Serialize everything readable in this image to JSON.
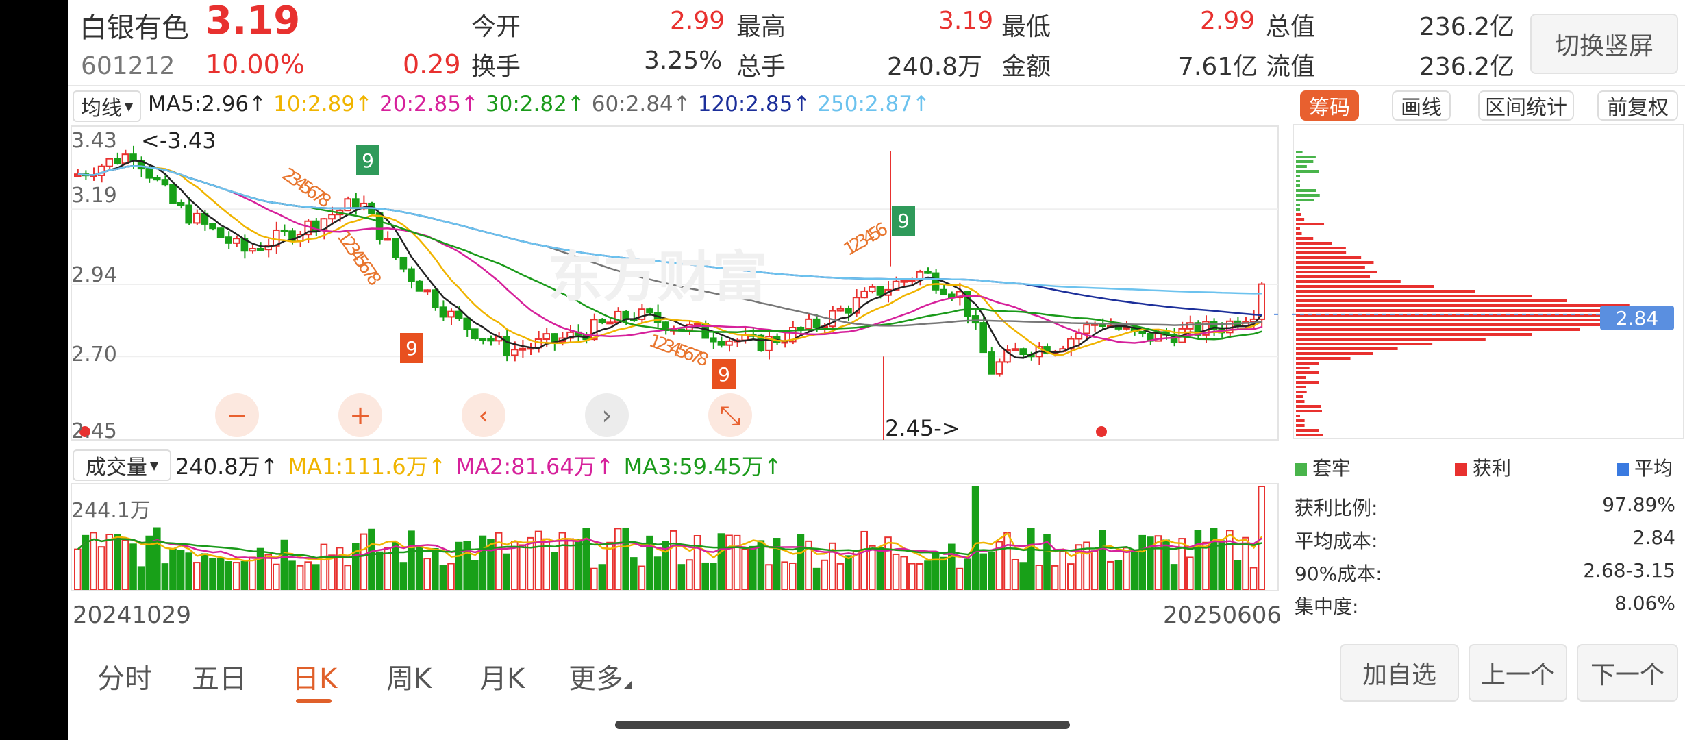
{
  "stock": {
    "name": "白银有色",
    "price": "3.19",
    "code": "601212",
    "change_pct": "10.00%",
    "change": "0.29"
  },
  "quote": [
    {
      "l1": "今开",
      "v1": "2.99",
      "l2": "换手",
      "v2": "3.25%"
    },
    {
      "l1": "最高",
      "v1": "3.19",
      "l2": "总手",
      "v2": "240.8万"
    },
    {
      "l1": "最低",
      "v1": "2.99",
      "l2": "金额",
      "v2": "7.61亿"
    },
    {
      "l1": "总值",
      "v1": "236.2亿",
      "l2": "流值",
      "v2": "236.2亿"
    }
  ],
  "switch_label": "切换竖屏",
  "ma": {
    "selector": "均线",
    "items": [
      {
        "text": "MA5:2.96↑",
        "color": "#222222"
      },
      {
        "text": "10:2.89↑",
        "color": "#f0b400"
      },
      {
        "text": "20:2.85↑",
        "color": "#d6219b"
      },
      {
        "text": "30:2.82↑",
        "color": "#1a9a1a"
      },
      {
        "text": "60:2.84↑",
        "color": "#666666"
      },
      {
        "text": "120:2.85↑",
        "color": "#1c2f9a"
      },
      {
        "text": "250:2.87↑",
        "color": "#6cc2ee"
      }
    ]
  },
  "price_axis": [
    "3.43",
    "3.19",
    "2.94",
    "2.70",
    "2.45"
  ],
  "price_annotations": {
    "high": "<-3.43",
    "low": "2.45->",
    "current": "2.84"
  },
  "chart_marks": {
    "td9": "9",
    "seq1": "2345678",
    "seq2": "12345678",
    "seq3": "123456",
    "seq4": "12345678"
  },
  "watermark": "东方财富",
  "controls": [
    {
      "name": "zoom-out",
      "glyph": "−"
    },
    {
      "name": "zoom-in",
      "glyph": "+"
    },
    {
      "name": "prev",
      "glyph": "‹"
    },
    {
      "name": "next",
      "glyph": "›"
    },
    {
      "name": "collapse",
      "glyph": "⤡"
    }
  ],
  "side_tools": [
    "筹码",
    "画线",
    "区间统计",
    "前复权"
  ],
  "chips": {
    "legend": [
      "套牢",
      "获利",
      "平均"
    ],
    "stats": [
      {
        "label": "获利比例:",
        "value": "97.89%"
      },
      {
        "label": "平均成本:",
        "value": "2.84"
      },
      {
        "label": "90%成本:",
        "value": "2.68-3.15"
      },
      {
        "label": "集中度:",
        "value": "8.06%"
      }
    ]
  },
  "volume": {
    "selector": "成交量",
    "current": "240.8万↑",
    "ma": [
      {
        "text": "MA1:111.6万↑",
        "color": "#f0b400"
      },
      {
        "text": "MA2:81.64万↑",
        "color": "#d6219b"
      },
      {
        "text": "MA3:59.45万↑",
        "color": "#1a9a1a"
      }
    ],
    "max_label": "244.1万"
  },
  "dates": {
    "start": "20241029",
    "end": "20250606"
  },
  "tabs": [
    "分时",
    "五日",
    "日K",
    "周K",
    "月K",
    "更多"
  ],
  "actions": [
    "加自选",
    "上一个",
    "下一个"
  ],
  "colors": {
    "up": "#e8312f",
    "down": "#18a018",
    "accent": "#e8312f",
    "active_tab": "#e0602a"
  }
}
